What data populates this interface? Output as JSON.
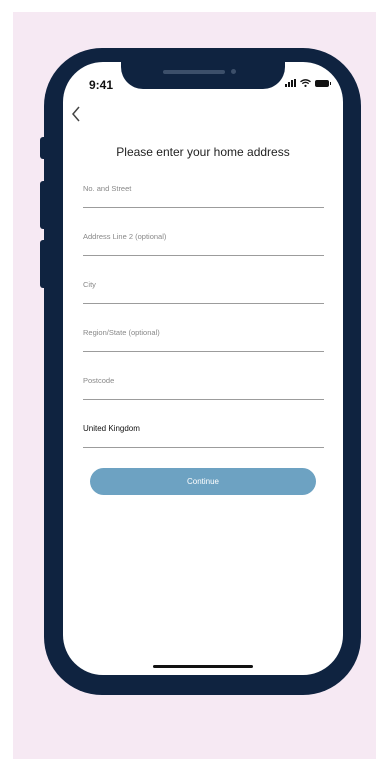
{
  "status_bar": {
    "time": "9:41"
  },
  "page": {
    "title": "Please enter your home address"
  },
  "fields": [
    {
      "placeholder": "No. and Street",
      "value": ""
    },
    {
      "placeholder": "Address Line 2 (optional)",
      "value": ""
    },
    {
      "placeholder": "City",
      "value": ""
    },
    {
      "placeholder": "Region/State (optional)",
      "value": ""
    },
    {
      "placeholder": "Postcode",
      "value": ""
    },
    {
      "placeholder": "",
      "value": "United Kingdom"
    }
  ],
  "actions": {
    "continue_label": "Continue"
  },
  "colors": {
    "background": "#f6e9f3",
    "phone_frame": "#0f2340",
    "button": "#6da2c2"
  }
}
